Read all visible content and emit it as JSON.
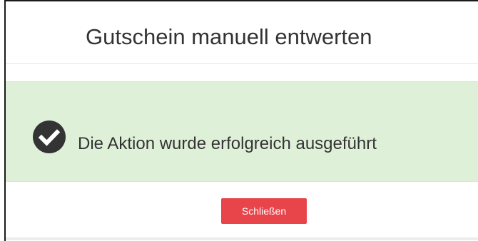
{
  "dialog": {
    "title": "Gutschein manuell entwerten",
    "alert": {
      "icon": "check-circle-icon",
      "message": "Die Aktion wurde erfolgreich ausgeführt",
      "background": "#dff0d8"
    },
    "close_label": "Schließen",
    "close_color": "#e8454b"
  }
}
